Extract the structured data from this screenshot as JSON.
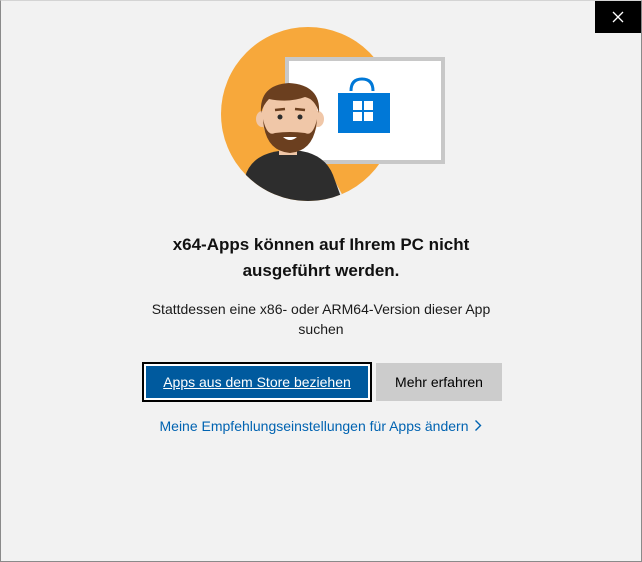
{
  "dialog": {
    "close_glyph": "✕",
    "title_line1": "x64-Apps können auf Ihrem PC nicht",
    "title_line2": "ausgeführt werden.",
    "subtitle_line1": "Stattdessen eine x86- oder ARM64-Version dieser App",
    "subtitle_line2": "suchen",
    "primary_button": "Apps aus dem Store beziehen",
    "secondary_button": "Mehr erfahren",
    "settings_link": "Meine Empfehlungseinstellungen für Apps ändern"
  },
  "icons": {
    "close": "close-icon",
    "store": "store-bag-icon",
    "chevron": "chevron-right-icon"
  },
  "colors": {
    "background": "#f2f2f2",
    "close_bg": "#000000",
    "primary": "#005a9e",
    "secondary": "#cccccc",
    "link": "#0063b1",
    "hero_circle": "#f7a83b",
    "store_blue": "#0078d7"
  }
}
